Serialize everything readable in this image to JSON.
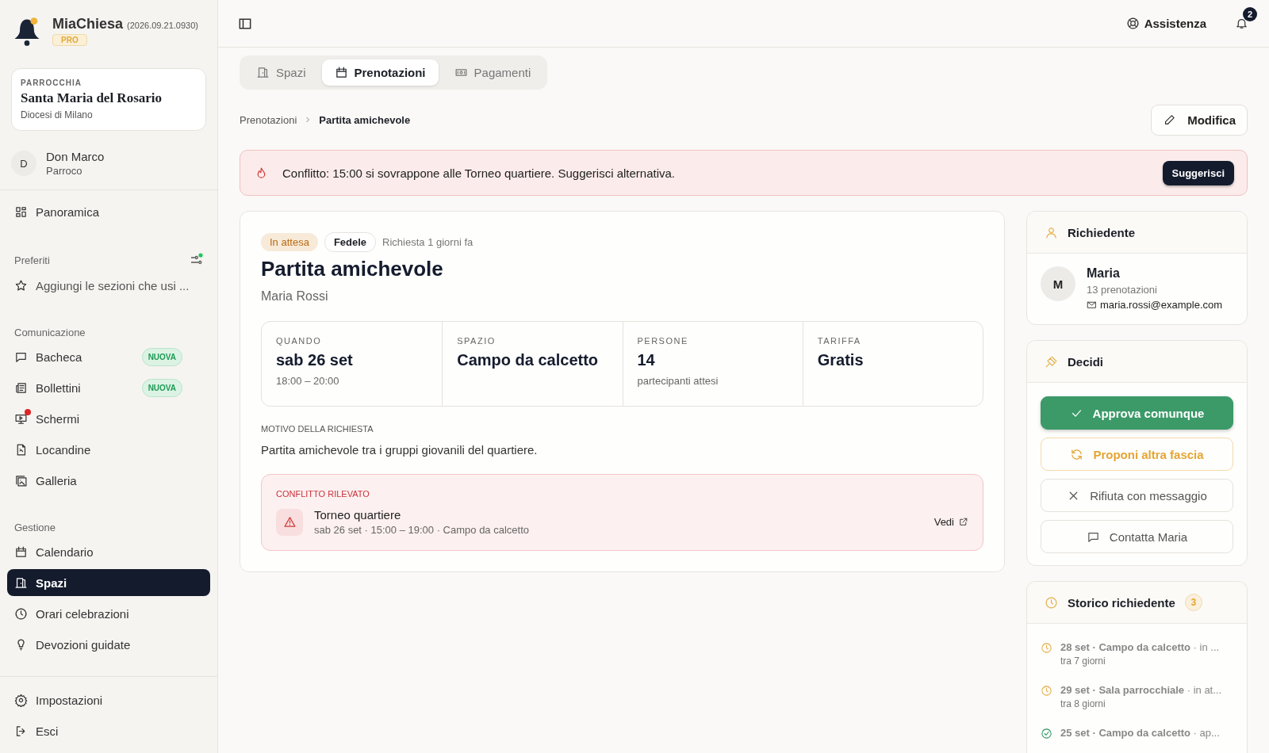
{
  "app": {
    "name": "MiaChiesa",
    "version": "(2026.09.21.0930)",
    "plan": "PRO"
  },
  "parish": {
    "label": "PARROCCHIA",
    "name": "Santa Maria del Rosario",
    "diocese": "Diocesi di Milano"
  },
  "user": {
    "initial": "D",
    "name": "Don Marco",
    "role": "Parroco"
  },
  "nav": [
    {
      "label": "Panoramica",
      "selected": false
    }
  ],
  "favorites": {
    "title": "Preferiti",
    "hint": "Aggiungi le sezioni che usi ..."
  },
  "sections": [
    {
      "title": "Comunicazione",
      "items": [
        {
          "label": "Bacheca",
          "badge": "NUOVA",
          "dot": false,
          "selected": false
        },
        {
          "label": "Bollettini",
          "badge": "NUOVA",
          "dot": false,
          "selected": false
        },
        {
          "label": "Schermi",
          "dot": true,
          "selected": false
        },
        {
          "label": "Locandine",
          "dot": false,
          "selected": false
        },
        {
          "label": "Galleria",
          "dot": false,
          "selected": false
        }
      ]
    },
    {
      "title": "Gestione",
      "items": [
        {
          "label": "Calendario",
          "dot": false,
          "selected": false
        },
        {
          "label": "Spazi",
          "dot": false,
          "selected": true
        },
        {
          "label": "Orari celebrazioni",
          "dot": false,
          "selected": false
        },
        {
          "label": "Devozioni guidate",
          "dot": false,
          "selected": false
        }
      ]
    }
  ],
  "footer_nav": [
    {
      "label": "Impostazioni"
    },
    {
      "label": "Esci"
    }
  ],
  "topbar": {
    "help": "Assistenza",
    "notifications": "2"
  },
  "tabs": [
    {
      "label": "Spazi",
      "selected": false
    },
    {
      "label": "Prenotazioni",
      "selected": true
    },
    {
      "label": "Pagamenti",
      "selected": false
    }
  ],
  "breadcrumb": [
    "Prenotazioni",
    "Partita amichevole"
  ],
  "edit_button": "Modifica",
  "alert": {
    "text": "Conflitto: 15:00 si sovrappone alle Torneo quartiere. Suggerisci alternativa.",
    "action": "Suggerisci"
  },
  "booking": {
    "status": "In attesa",
    "role": "Fedele",
    "requested": "Richiesta 1 giorni fa",
    "title": "Partita amichevole",
    "requester": "Maria Rossi",
    "facts": [
      {
        "label": "QUANDO",
        "value": "sab 26 set",
        "note": "18:00 – 20:00"
      },
      {
        "label": "SPAZIO",
        "value": "Campo da calcetto"
      },
      {
        "label": "PERSONE",
        "value": "14",
        "note": "partecipanti attesi"
      },
      {
        "label": "TARIFFA",
        "value": "Gratis"
      }
    ],
    "reason_label": "MOTIVO DELLA RICHIESTA",
    "reason": "Partita amichevole tra i gruppi giovanili del quartiere.",
    "conflict": {
      "label": "CONFLITTO RILEVATO",
      "title": "Torneo quartiere",
      "details": "sab 26 set · 15:00 – 19:00 · Campo da calcetto",
      "link": "Vedi"
    }
  },
  "requester_card": {
    "title": "Richiedente",
    "initial": "M",
    "name": "Maria",
    "bookings": "13 prenotazioni",
    "email": "maria.rossi@example.com"
  },
  "decide": {
    "title": "Decidi",
    "actions": [
      {
        "label": "Approva comunque",
        "kind": "primary"
      },
      {
        "label": "Proponi altra fascia",
        "kind": "warning"
      },
      {
        "label": "Rifiuta con messaggio",
        "kind": "reject"
      },
      {
        "label": "Contatta Maria",
        "kind": "contact"
      }
    ]
  },
  "history": {
    "title": "Storico richiedente",
    "count": "3",
    "items": [
      {
        "title": "**28 set · Campo da calcetto** · in ...",
        "when": "tra 7 giorni",
        "kind": "pending"
      },
      {
        "title": "**29 set · Sala parrocchiale** · in at...",
        "when": "tra 8 giorni",
        "kind": "pending"
      },
      {
        "title": "**25 set · Campo da calcetto** · ap...",
        "kind": "approved"
      }
    ]
  }
}
